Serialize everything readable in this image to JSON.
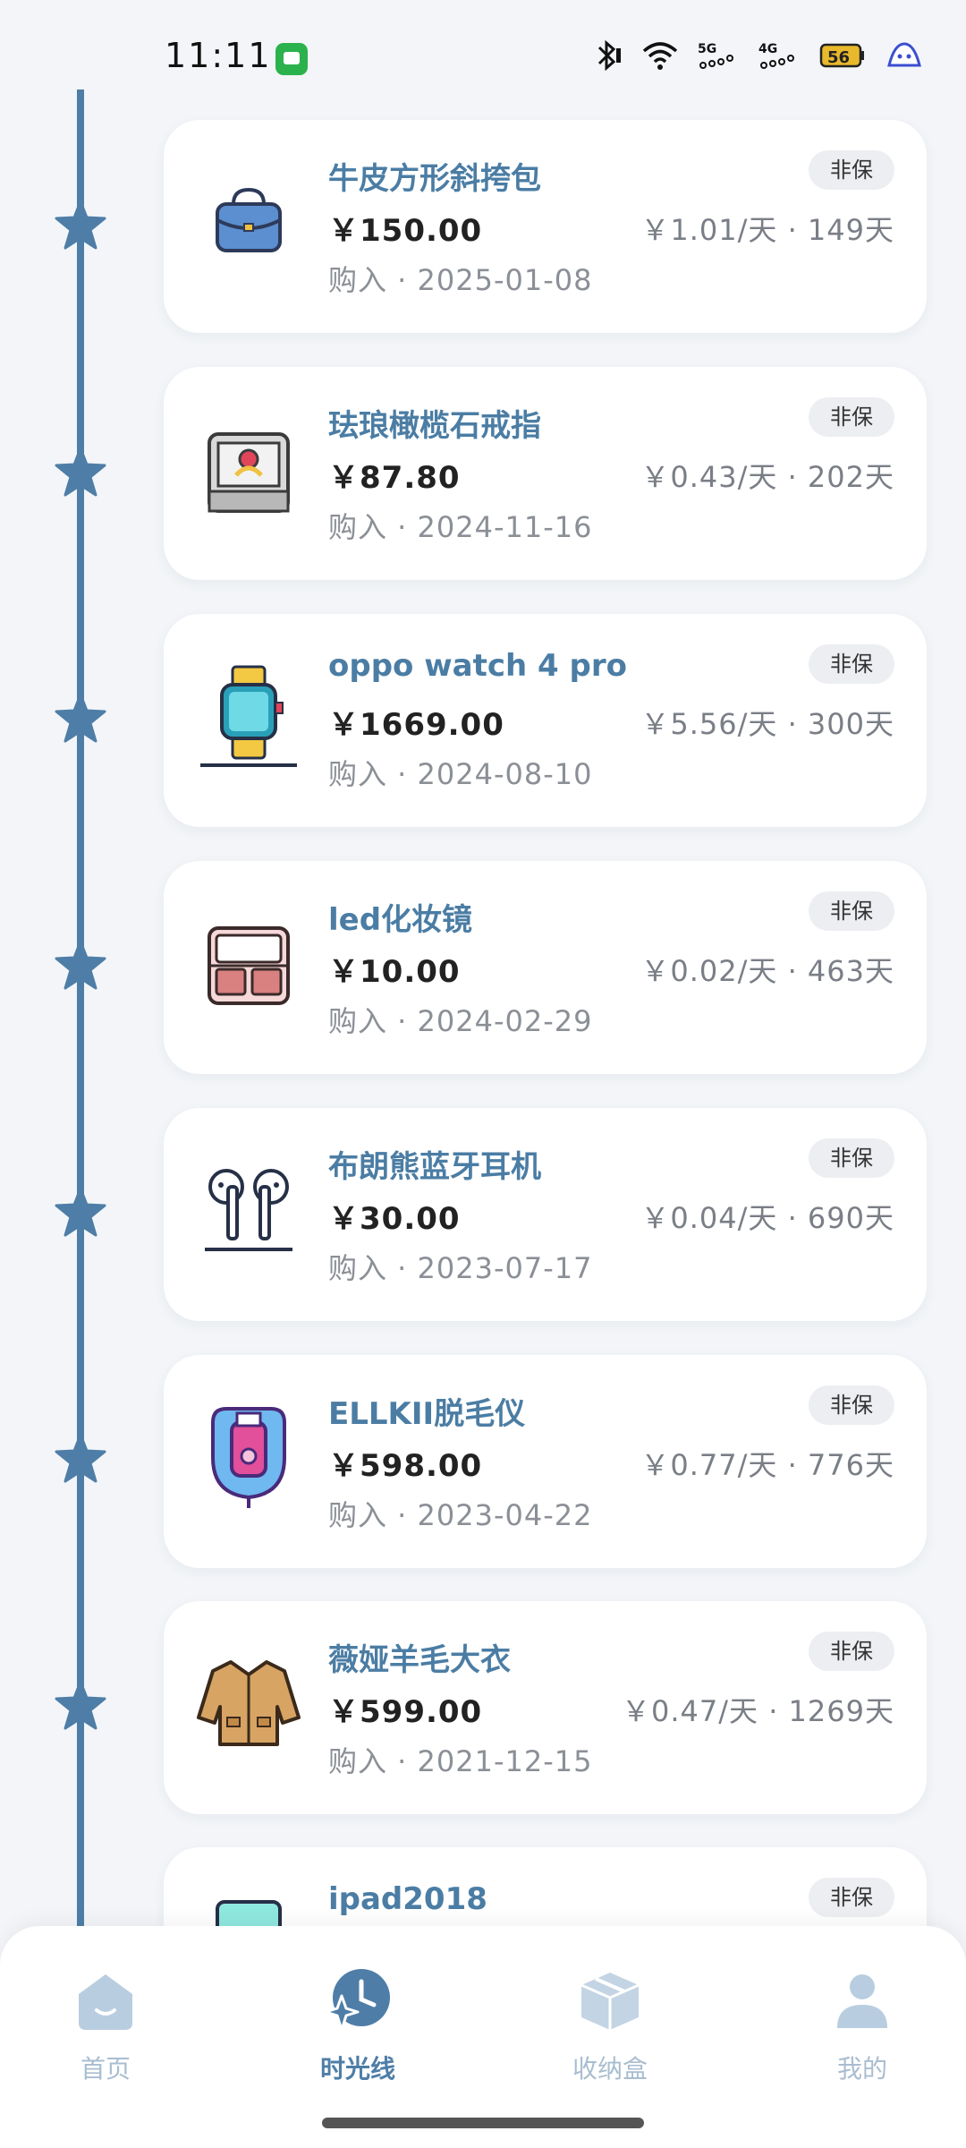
{
  "status_bar": {
    "time": "11:11",
    "icons": [
      "message-icon",
      "bluetooth-icon",
      "wifi-icon",
      "signal-5g-icon",
      "signal-4g-icon",
      "battery-icon",
      "app-icon"
    ],
    "battery": "56"
  },
  "timeline": {
    "line_color": "#4e7ea7",
    "star_color": "#4e7ea7",
    "items": [
      {
        "name": "牛皮方形斜挎包",
        "price": "￥150.00",
        "rate": "￥1.01/天 · 149天",
        "date": "购入 · 2025-01-08",
        "badge": "非保",
        "icon": "bag-icon"
      },
      {
        "name": "珐琅橄榄石戒指",
        "price": "￥87.80",
        "rate": "￥0.43/天 · 202天",
        "date": "购入 · 2024-11-16",
        "badge": "非保",
        "icon": "ring-box-icon"
      },
      {
        "name": "oppo watch 4 pro",
        "price": "￥1669.00",
        "rate": "￥5.56/天 · 300天",
        "date": "购入 · 2024-08-10",
        "badge": "非保",
        "icon": "watch-icon"
      },
      {
        "name": "led化妆镜",
        "price": "￥10.00",
        "rate": "￥0.02/天 · 463天",
        "date": "购入 · 2024-02-29",
        "badge": "非保",
        "icon": "makeup-mirror-icon"
      },
      {
        "name": "布朗熊蓝牙耳机",
        "price": "￥30.00",
        "rate": "￥0.04/天 · 690天",
        "date": "购入 · 2023-07-17",
        "badge": "非保",
        "icon": "earbuds-icon"
      },
      {
        "name": "ELLKII脱毛仪",
        "price": "￥598.00",
        "rate": "￥0.77/天 · 776天",
        "date": "购入 · 2023-04-22",
        "badge": "非保",
        "icon": "epilator-icon"
      },
      {
        "name": "薇娅羊毛大衣",
        "price": "￥599.00",
        "rate": "￥0.47/天 · 1269天",
        "date": "购入 · 2021-12-15",
        "badge": "非保",
        "icon": "coat-icon"
      },
      {
        "name": "ipad2018",
        "price": "",
        "rate": "",
        "date": "",
        "badge": "非保",
        "icon": "tablet-icon"
      }
    ]
  },
  "bottom_nav": {
    "items": [
      {
        "label": "首页",
        "icon": "home-icon",
        "active": false
      },
      {
        "label": "时光线",
        "icon": "timeline-sparkle-icon",
        "active": true
      },
      {
        "label": "收纳盒",
        "icon": "storage-box-icon",
        "active": false
      },
      {
        "label": "我的",
        "icon": "profile-icon",
        "active": false
      }
    ],
    "active_color": "#4e7ea7",
    "inactive_color": "#a9bdd0"
  }
}
